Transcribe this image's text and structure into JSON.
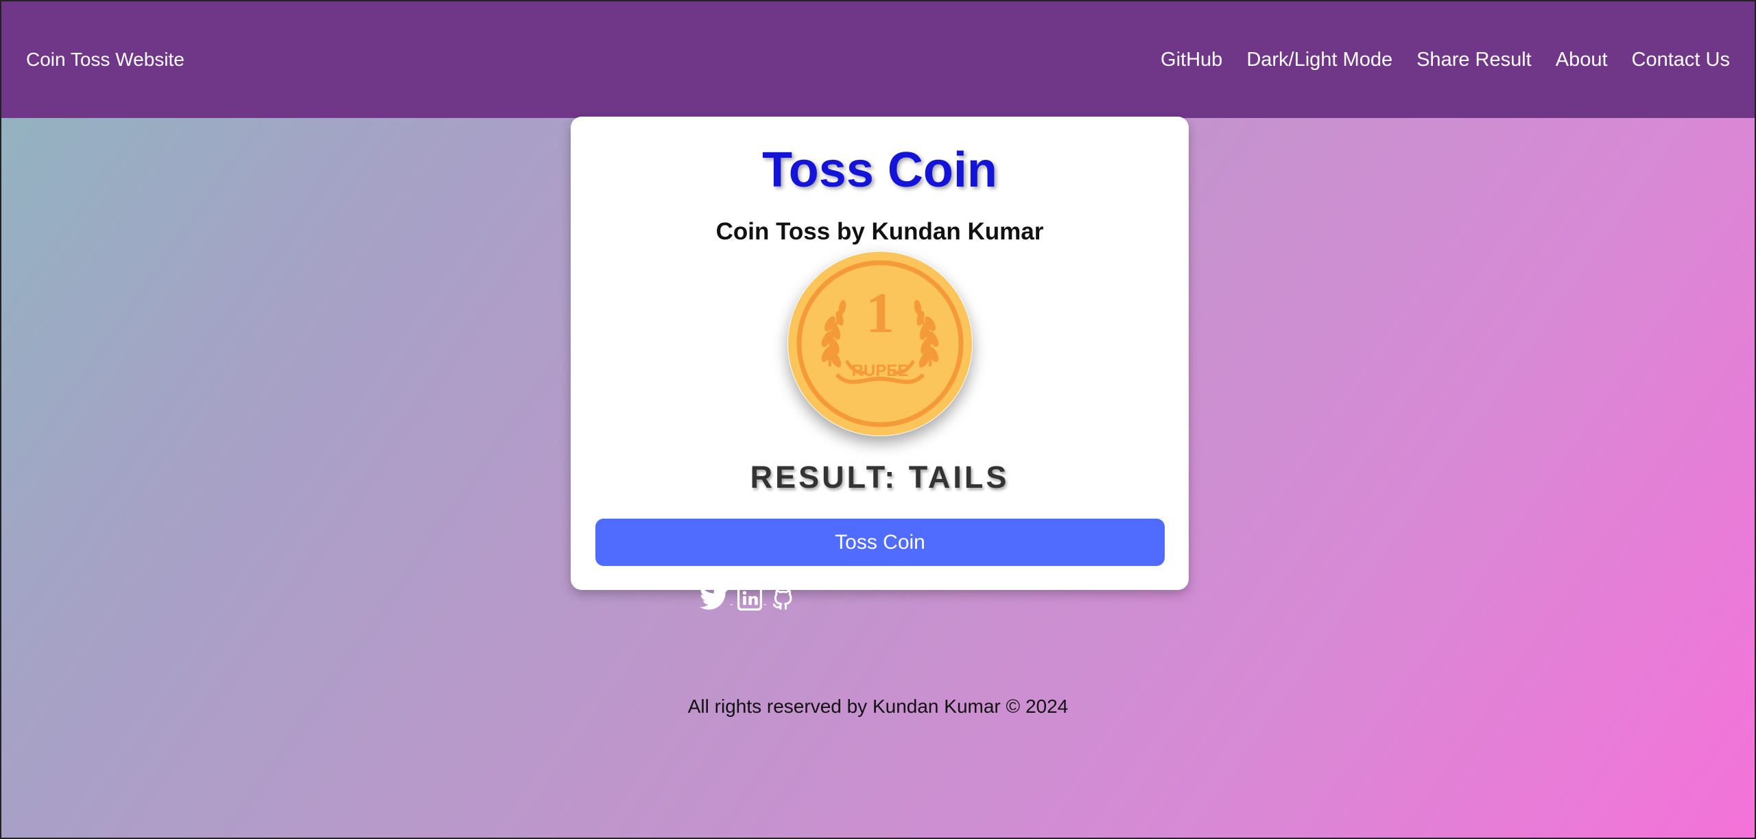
{
  "navbar": {
    "brand": "Coin Toss Website",
    "links": [
      "GitHub",
      "Dark/Light Mode",
      "Share Result",
      "About",
      "Contact Us"
    ]
  },
  "card": {
    "title": "Toss Coin",
    "subtitle": "Coin Toss by Kundan Kumar",
    "coin": {
      "denomination": "1",
      "label": "RUPEE",
      "icon": "rupee-coin-icon"
    },
    "result": "RESULT: TAILS",
    "button_label": "Toss Coin"
  },
  "socials": [
    {
      "name": "twitter",
      "icon": "twitter-icon"
    },
    {
      "name": "linkedin",
      "icon": "linkedin-icon"
    },
    {
      "name": "github",
      "icon": "github-icon"
    }
  ],
  "footer": {
    "text": "All rights reserved by Kundan Kumar © 2024"
  },
  "colors": {
    "navbar": "#703789",
    "title": "#1414d8",
    "button": "#4f6cff",
    "coin_fill": "#fcc55c",
    "coin_engraving": "#f59a38"
  }
}
